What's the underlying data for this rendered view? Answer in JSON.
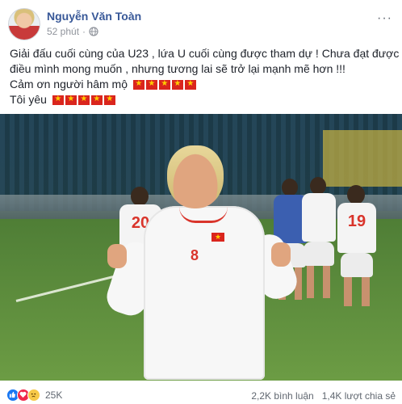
{
  "post": {
    "author": "Nguyễn Văn Toàn",
    "time": "52 phút",
    "more": "···",
    "text_lines": [
      "Giải đấu cuối cùng của U23 , lứa U cuối cùng được tham dự ! Chưa đạt được",
      "điều mình mong muốn , nhưng tương lai sẽ trở lại mạnh mẽ hơn !!!",
      "Cảm ơn người hâm mộ",
      "Tôi yêu"
    ],
    "flag_emoji_count": 5,
    "photo": {
      "main_player_number": "8",
      "player_numbers": [
        "20",
        "19"
      ]
    }
  },
  "footer": {
    "reactions": [
      "like-icon",
      "love-icon",
      "sad-icon"
    ],
    "reaction_count": "25K",
    "comments": "2,2K bình luận",
    "shares": "1,4K lượt chia sẻ"
  },
  "colors": {
    "author_link": "#385898",
    "flag_red": "#da251d",
    "flag_star": "#ffcd00",
    "meta_gray": "#90949c"
  }
}
